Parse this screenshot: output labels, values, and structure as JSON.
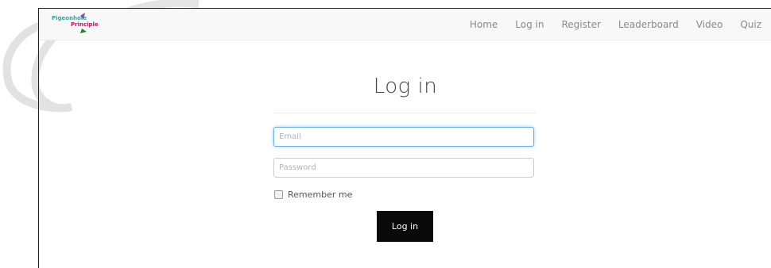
{
  "nav": {
    "logo_alt": "Pigeonhole Principle",
    "items": [
      {
        "label": "Home"
      },
      {
        "label": "Log in"
      },
      {
        "label": "Register"
      },
      {
        "label": "Leaderboard"
      },
      {
        "label": "Video"
      },
      {
        "label": "Quiz"
      }
    ]
  },
  "main": {
    "title": "Log in",
    "email": {
      "placeholder": "Email",
      "value": ""
    },
    "password": {
      "placeholder": "Password",
      "value": ""
    },
    "remember_label": "Remember me",
    "remember_checked": false,
    "submit_label": "Log in"
  },
  "colors": {
    "button_bg": "#0a0a0a",
    "focus_border": "#66afe9",
    "navbar_bg": "#f8f8f8"
  }
}
